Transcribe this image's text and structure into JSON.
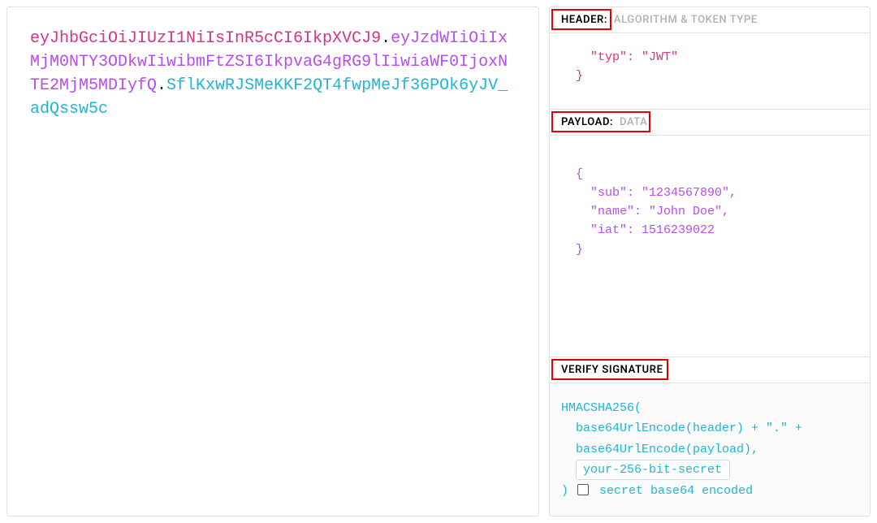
{
  "token": {
    "header": "eyJhbGciOiJIUzI1NiIsInR5cCI6IkpXVCJ9",
    "payload": "eyJzdWIiOiIxMjM0NTY3ODkwIiwibmFtZSI6IkpvaG4gRG9lIiwiaWF0IjoxNTE2MjM5MDIyfQ",
    "signature": "SflKxwRJSMeKKF2QT4fwpMeJf36POk6yJV_adQssw5c",
    "dot": "."
  },
  "sections": {
    "header": {
      "title": "HEADER:",
      "subtitle": "ALGORITHM & TOKEN TYPE",
      "body": "  \"typ\": \"JWT\"\n}"
    },
    "payload": {
      "title": "PAYLOAD:",
      "subtitle": "DATA",
      "body": "{\n  \"sub\": \"1234567890\",\n  \"name\": \"John Doe\",\n  \"iat\": 1516239022\n}"
    },
    "signature": {
      "title": "VERIFY SIGNATURE",
      "line1": "HMACSHA256(",
      "line2": "base64UrlEncode(header) + \".\" +",
      "line3": "base64UrlEncode(payload),",
      "secret_value": "your-256-bit-secret",
      "close_paren": ")",
      "checkbox_label": "secret base64 encoded"
    }
  }
}
